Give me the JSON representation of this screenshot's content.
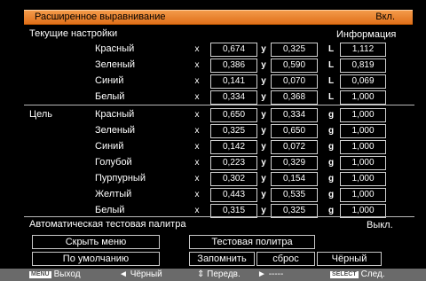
{
  "title": {
    "label": "Расширенное выравнивание",
    "value": "Вкл."
  },
  "current": {
    "header": "Текущие настройки",
    "info_header": "Информация"
  },
  "target": {
    "header": "Цель"
  },
  "current_rows": [
    {
      "name": "Красный",
      "x": "0,674",
      "y": "0,325",
      "tlabel": "L",
      "t": "1,112"
    },
    {
      "name": "Зеленый",
      "x": "0,386",
      "y": "0,590",
      "tlabel": "L",
      "t": "0,819"
    },
    {
      "name": "Синий",
      "x": "0,141",
      "y": "0,070",
      "tlabel": "L",
      "t": "0,069"
    },
    {
      "name": "Белый",
      "x": "0,334",
      "y": "0,368",
      "tlabel": "L",
      "t": "1,000"
    }
  ],
  "target_rows": [
    {
      "name": "Красный",
      "x": "0,650",
      "y": "0,334",
      "tlabel": "g",
      "t": "1,000"
    },
    {
      "name": "Зеленый",
      "x": "0,325",
      "y": "0,650",
      "tlabel": "g",
      "t": "1,000"
    },
    {
      "name": "Синий",
      "x": "0,142",
      "y": "0,072",
      "tlabel": "g",
      "t": "1,000"
    },
    {
      "name": "Голубой",
      "x": "0,223",
      "y": "0,329",
      "tlabel": "g",
      "t": "1,000"
    },
    {
      "name": "Пурпурный",
      "x": "0,302",
      "y": "0,154",
      "tlabel": "g",
      "t": "1,000"
    },
    {
      "name": "Желтый",
      "x": "0,443",
      "y": "0,535",
      "tlabel": "g",
      "t": "1,000"
    },
    {
      "name": "Белый",
      "x": "0,315",
      "y": "0,325",
      "tlabel": "g",
      "t": "1,000"
    }
  ],
  "axis_labels": {
    "x": "x",
    "y": "y"
  },
  "auto_palette": {
    "label": "Автоматическая тестовая палитра",
    "value": "Выкл."
  },
  "buttons": {
    "hide_menu": "Скрыть меню",
    "test_palette": "Тестовая политра",
    "default": "По умолчанию",
    "store": "Запомнить",
    "reset": "сброс",
    "black": "Чёрный"
  },
  "bottom": {
    "exit_key": "MENU",
    "exit": "Выход",
    "black_arrow": "◄",
    "black": "Чёрный",
    "move_arrow": "⇕",
    "move": "Передв.",
    "next_arrow": "►",
    "next_dash": "-----",
    "select_key": "SELECT",
    "select": "След."
  }
}
